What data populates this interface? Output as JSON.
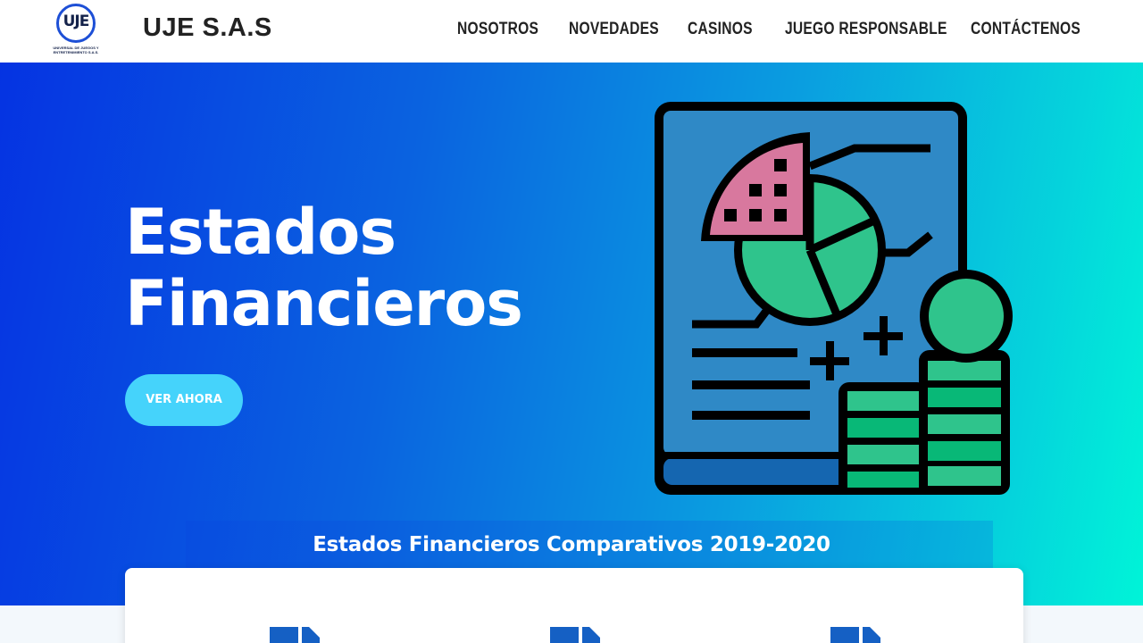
{
  "header": {
    "logo": {
      "letters": "UJE",
      "tagline": "UNIVERSAL DE JUEGOS Y ENTRETENIMIENTO S.A.S."
    },
    "brand": "UJE S.A.S",
    "nav": [
      "NOSOTROS",
      "NOVEDADES",
      "CASINOS",
      "JUEGO RESPONSABLE",
      "CONTÁCTENOS"
    ]
  },
  "hero": {
    "title_line1": "Estados",
    "title_line2": "Financieros",
    "button_label": "VER AHORA",
    "illustration": "financial-report-book-icon"
  },
  "section": {
    "title": "Estados Financieros Comparativos 2019-2020",
    "icons": [
      "document-icon",
      "document-icon",
      "document-icon"
    ]
  },
  "colors": {
    "hero_gradient_start": "#0533e2",
    "hero_gradient_end": "#00f4d8",
    "button": "#45d3fb",
    "accent_blue": "#1560c4"
  }
}
